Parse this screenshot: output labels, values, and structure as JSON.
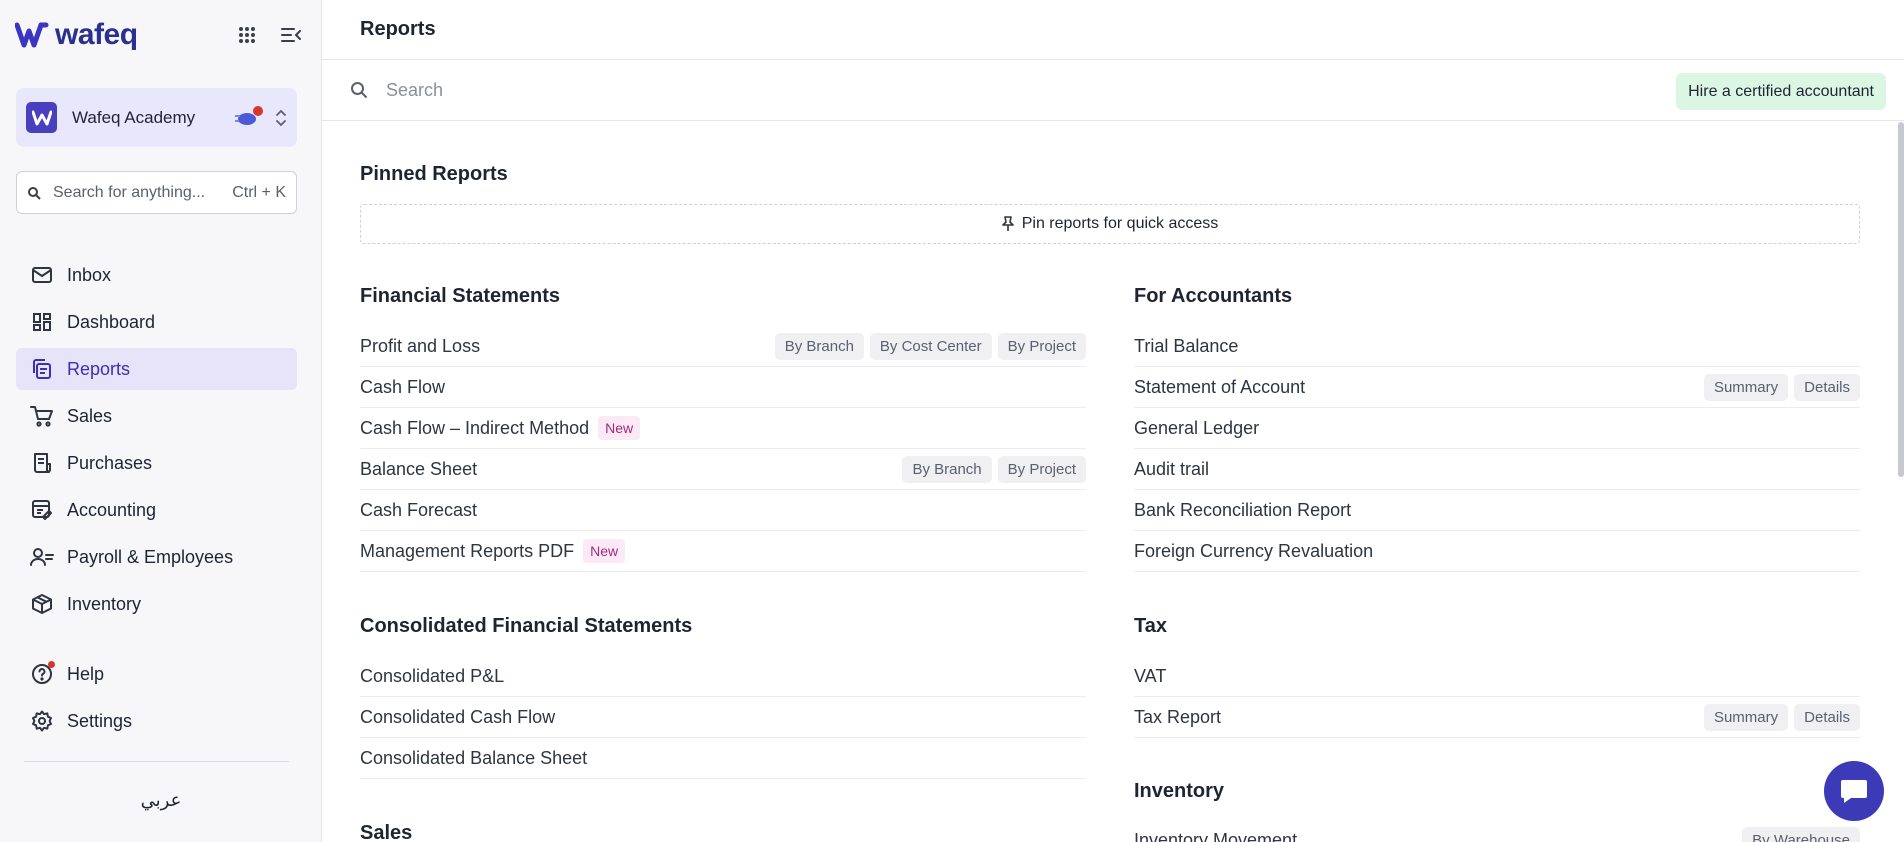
{
  "sidebar": {
    "logo_text": "wafeq",
    "apps_icon": "grid-icon",
    "collapse_icon": "collapse-menu-icon",
    "org": {
      "name": "Wafeq Academy"
    },
    "search": {
      "placeholder": "Search for anything...",
      "shortcut": "Ctrl + K"
    },
    "nav": [
      {
        "label": "Inbox",
        "icon": "inbox-icon",
        "active": false
      },
      {
        "label": "Dashboard",
        "icon": "dashboard-icon",
        "active": false
      },
      {
        "label": "Reports",
        "icon": "reports-icon",
        "active": true
      },
      {
        "label": "Sales",
        "icon": "cart-icon",
        "active": false
      },
      {
        "label": "Purchases",
        "icon": "receipt-icon",
        "active": false
      },
      {
        "label": "Accounting",
        "icon": "ledger-icon",
        "active": false
      },
      {
        "label": "Payroll & Employees",
        "icon": "people-icon",
        "active": false
      },
      {
        "label": "Inventory",
        "icon": "box-icon",
        "active": false
      }
    ],
    "bottom_nav": [
      {
        "label": "Help",
        "icon": "help-icon"
      },
      {
        "label": "Settings",
        "icon": "gear-icon"
      }
    ],
    "language": "عربي"
  },
  "header": {
    "title": "Reports"
  },
  "search": {
    "placeholder": "Search",
    "hire_label": "Hire a certified accountant"
  },
  "pinned": {
    "title": "Pinned Reports",
    "empty_label": "Pin reports for quick access"
  },
  "sections": {
    "financial": {
      "title": "Financial Statements",
      "rows": [
        {
          "name": "Profit and Loss",
          "tags": [
            "By Branch",
            "By Cost Center",
            "By Project"
          ]
        },
        {
          "name": "Cash Flow"
        },
        {
          "name": "Cash Flow – Indirect Method",
          "badge": "New"
        },
        {
          "name": "Balance Sheet",
          "tags": [
            "By Branch",
            "By Project"
          ]
        },
        {
          "name": "Cash Forecast"
        },
        {
          "name": "Management Reports PDF",
          "badge": "New"
        }
      ]
    },
    "accountants": {
      "title": "For Accountants",
      "rows": [
        {
          "name": "Trial Balance"
        },
        {
          "name": "Statement of Account",
          "tags": [
            "Summary",
            "Details"
          ]
        },
        {
          "name": "General Ledger"
        },
        {
          "name": "Audit trail"
        },
        {
          "name": "Bank Reconciliation Report"
        },
        {
          "name": "Foreign Currency Revaluation"
        }
      ]
    },
    "consolidated": {
      "title": "Consolidated Financial Statements",
      "rows": [
        {
          "name": "Consolidated P&L"
        },
        {
          "name": "Consolidated Cash Flow"
        },
        {
          "name": "Consolidated Balance Sheet"
        }
      ]
    },
    "tax": {
      "title": "Tax",
      "rows": [
        {
          "name": "VAT"
        },
        {
          "name": "Tax Report",
          "tags": [
            "Summary",
            "Details"
          ]
        }
      ]
    },
    "inventory": {
      "title": "Inventory",
      "rows": [
        {
          "name": "Inventory Movement",
          "tags": [
            "By Warehouse"
          ]
        }
      ]
    },
    "sales": {
      "title": "Sales"
    }
  },
  "colors": {
    "brand": "#3a2fb5",
    "active_bg": "#e7e4fa",
    "hire_bg": "#dcf6e4",
    "new_badge": "#a12a7c"
  }
}
